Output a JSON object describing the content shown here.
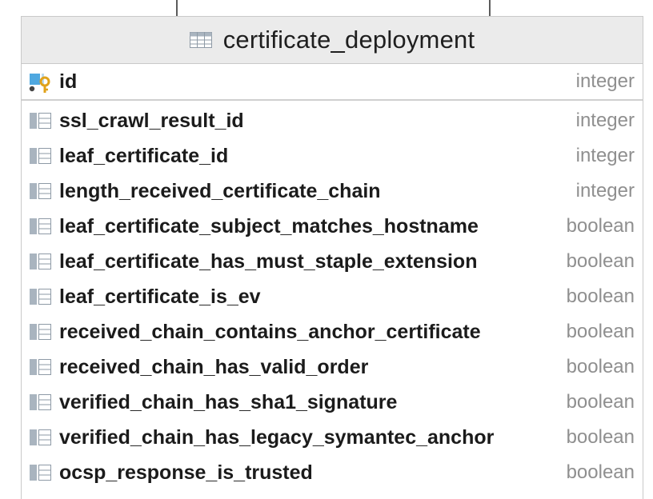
{
  "table": {
    "title": "certificate_deployment",
    "primary_key": {
      "name": "id",
      "type": "integer"
    },
    "columns": [
      {
        "name": "ssl_crawl_result_id",
        "type": "integer"
      },
      {
        "name": "leaf_certificate_id",
        "type": "integer"
      },
      {
        "name": "length_received_certificate_chain",
        "type": "integer"
      },
      {
        "name": "leaf_certificate_subject_matches_hostname",
        "type": "boolean"
      },
      {
        "name": "leaf_certificate_has_must_staple_extension",
        "type": "boolean"
      },
      {
        "name": "leaf_certificate_is_ev",
        "type": "boolean"
      },
      {
        "name": "received_chain_contains_anchor_certificate",
        "type": "boolean"
      },
      {
        "name": "received_chain_has_valid_order",
        "type": "boolean"
      },
      {
        "name": "verified_chain_has_sha1_signature",
        "type": "boolean"
      },
      {
        "name": "verified_chain_has_legacy_symantec_anchor",
        "type": "boolean"
      },
      {
        "name": "ocsp_response_is_trusted",
        "type": "boolean"
      }
    ]
  },
  "icons": {
    "table_header": "table-grid-icon",
    "primary_key": "primary-key-column-icon",
    "column": "column-icon"
  },
  "colors": {
    "header_bg": "#ebebeb",
    "border": "#c9c9c9",
    "name_text": "#1b1b1b",
    "type_text": "#8f8f8f",
    "key_gold": "#e0a21a",
    "pk_blue": "#4fa8e0"
  }
}
